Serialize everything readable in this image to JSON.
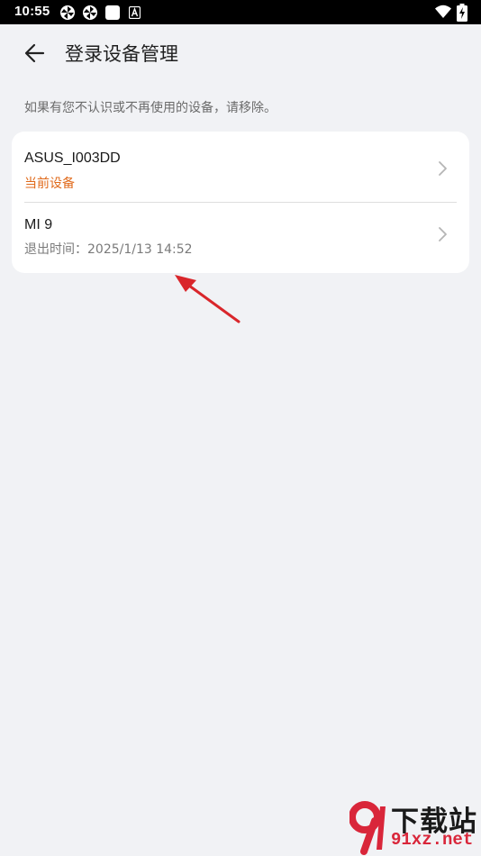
{
  "status_bar": {
    "time": "10:55",
    "icons": [
      "pinwheel-icon",
      "pinwheel-icon",
      "square-notification-icon",
      "a-notification-icon",
      "wifi-icon",
      "battery-charging-icon"
    ]
  },
  "header": {
    "title": "登录设备管理",
    "back_icon": "arrow-left-icon"
  },
  "hint": "如果有您不认识或不再使用的设备，请移除。",
  "devices": [
    {
      "name": "ASUS_I003DD",
      "subtitle": "当前设备"
    },
    {
      "name": "MI 9",
      "subtitle": "退出时间：2025/1/13 14:52"
    }
  ],
  "watermark": {
    "text_cn": "下载站",
    "url": "91xz.net"
  },
  "colors": {
    "background": "#f1f2f5",
    "card": "#ffffff",
    "current_device": "#e06a1b",
    "annotation_arrow": "#d9262b"
  }
}
